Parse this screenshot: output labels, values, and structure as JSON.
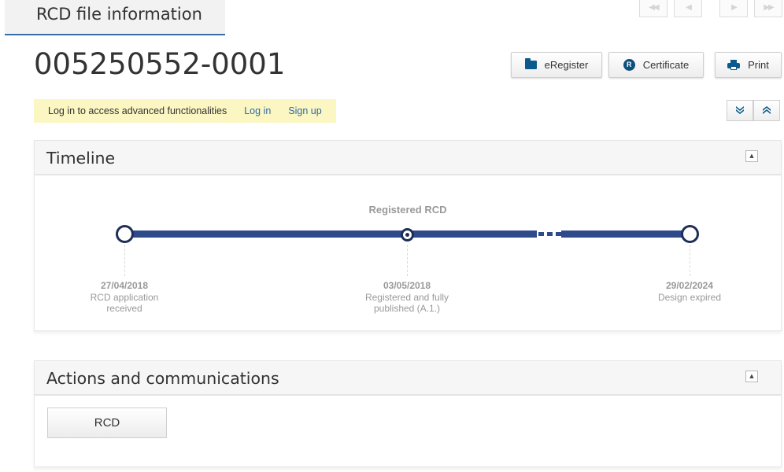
{
  "header": {
    "tab_title": "RCD file information"
  },
  "nav": {
    "first_glyph": "◀◀",
    "prev_glyph": "◀",
    "next_glyph": "▶",
    "last_glyph": "▶▶"
  },
  "file": {
    "number": "005250552-0001"
  },
  "toolbar": {
    "eregister_label": "eRegister",
    "certificate_label": "Certificate",
    "print_label": "Print",
    "certificate_icon_letter": "R"
  },
  "login_banner": {
    "message": "Log in to access advanced functionalities",
    "login_label": "Log in",
    "signup_label": "Sign up",
    "background": "#fbf6c2"
  },
  "expand_controls": {
    "expand_glyph": "▼▼",
    "collapse_glyph": "▲▲"
  },
  "timeline": {
    "title": "Timeline",
    "collapse_glyph": "▲",
    "stage_label": "Registered RCD",
    "accent_color": "#2e4a8a",
    "events": [
      {
        "date": "27/04/2018",
        "description": "RCD application received"
      },
      {
        "date": "03/05/2018",
        "description": "Registered and fully published (A.1.)"
      },
      {
        "date": "29/02/2024",
        "description": "Design expired"
      }
    ]
  },
  "actions": {
    "title": "Actions and communications",
    "collapse_glyph": "▲",
    "rcd_button_label": "RCD"
  }
}
